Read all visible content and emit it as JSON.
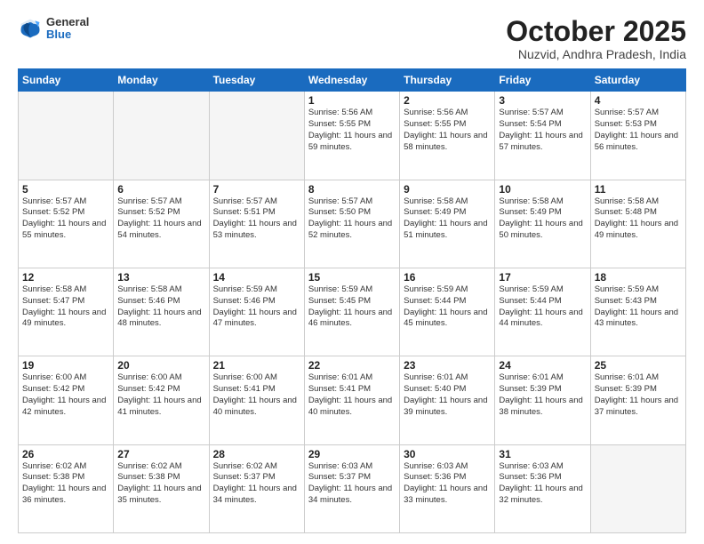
{
  "header": {
    "logo_general": "General",
    "logo_blue": "Blue",
    "month_title": "October 2025",
    "subtitle": "Nuzvid, Andhra Pradesh, India"
  },
  "days_of_week": [
    "Sunday",
    "Monday",
    "Tuesday",
    "Wednesday",
    "Thursday",
    "Friday",
    "Saturday"
  ],
  "weeks": [
    [
      {
        "day": "",
        "text": ""
      },
      {
        "day": "",
        "text": ""
      },
      {
        "day": "",
        "text": ""
      },
      {
        "day": "1",
        "text": "Sunrise: 5:56 AM\nSunset: 5:55 PM\nDaylight: 11 hours\nand 59 minutes."
      },
      {
        "day": "2",
        "text": "Sunrise: 5:56 AM\nSunset: 5:55 PM\nDaylight: 11 hours\nand 58 minutes."
      },
      {
        "day": "3",
        "text": "Sunrise: 5:57 AM\nSunset: 5:54 PM\nDaylight: 11 hours\nand 57 minutes."
      },
      {
        "day": "4",
        "text": "Sunrise: 5:57 AM\nSunset: 5:53 PM\nDaylight: 11 hours\nand 56 minutes."
      }
    ],
    [
      {
        "day": "5",
        "text": "Sunrise: 5:57 AM\nSunset: 5:52 PM\nDaylight: 11 hours\nand 55 minutes."
      },
      {
        "day": "6",
        "text": "Sunrise: 5:57 AM\nSunset: 5:52 PM\nDaylight: 11 hours\nand 54 minutes."
      },
      {
        "day": "7",
        "text": "Sunrise: 5:57 AM\nSunset: 5:51 PM\nDaylight: 11 hours\nand 53 minutes."
      },
      {
        "day": "8",
        "text": "Sunrise: 5:57 AM\nSunset: 5:50 PM\nDaylight: 11 hours\nand 52 minutes."
      },
      {
        "day": "9",
        "text": "Sunrise: 5:58 AM\nSunset: 5:49 PM\nDaylight: 11 hours\nand 51 minutes."
      },
      {
        "day": "10",
        "text": "Sunrise: 5:58 AM\nSunset: 5:49 PM\nDaylight: 11 hours\nand 50 minutes."
      },
      {
        "day": "11",
        "text": "Sunrise: 5:58 AM\nSunset: 5:48 PM\nDaylight: 11 hours\nand 49 minutes."
      }
    ],
    [
      {
        "day": "12",
        "text": "Sunrise: 5:58 AM\nSunset: 5:47 PM\nDaylight: 11 hours\nand 49 minutes."
      },
      {
        "day": "13",
        "text": "Sunrise: 5:58 AM\nSunset: 5:46 PM\nDaylight: 11 hours\nand 48 minutes."
      },
      {
        "day": "14",
        "text": "Sunrise: 5:59 AM\nSunset: 5:46 PM\nDaylight: 11 hours\nand 47 minutes."
      },
      {
        "day": "15",
        "text": "Sunrise: 5:59 AM\nSunset: 5:45 PM\nDaylight: 11 hours\nand 46 minutes."
      },
      {
        "day": "16",
        "text": "Sunrise: 5:59 AM\nSunset: 5:44 PM\nDaylight: 11 hours\nand 45 minutes."
      },
      {
        "day": "17",
        "text": "Sunrise: 5:59 AM\nSunset: 5:44 PM\nDaylight: 11 hours\nand 44 minutes."
      },
      {
        "day": "18",
        "text": "Sunrise: 5:59 AM\nSunset: 5:43 PM\nDaylight: 11 hours\nand 43 minutes."
      }
    ],
    [
      {
        "day": "19",
        "text": "Sunrise: 6:00 AM\nSunset: 5:42 PM\nDaylight: 11 hours\nand 42 minutes."
      },
      {
        "day": "20",
        "text": "Sunrise: 6:00 AM\nSunset: 5:42 PM\nDaylight: 11 hours\nand 41 minutes."
      },
      {
        "day": "21",
        "text": "Sunrise: 6:00 AM\nSunset: 5:41 PM\nDaylight: 11 hours\nand 40 minutes."
      },
      {
        "day": "22",
        "text": "Sunrise: 6:01 AM\nSunset: 5:41 PM\nDaylight: 11 hours\nand 40 minutes."
      },
      {
        "day": "23",
        "text": "Sunrise: 6:01 AM\nSunset: 5:40 PM\nDaylight: 11 hours\nand 39 minutes."
      },
      {
        "day": "24",
        "text": "Sunrise: 6:01 AM\nSunset: 5:39 PM\nDaylight: 11 hours\nand 38 minutes."
      },
      {
        "day": "25",
        "text": "Sunrise: 6:01 AM\nSunset: 5:39 PM\nDaylight: 11 hours\nand 37 minutes."
      }
    ],
    [
      {
        "day": "26",
        "text": "Sunrise: 6:02 AM\nSunset: 5:38 PM\nDaylight: 11 hours\nand 36 minutes."
      },
      {
        "day": "27",
        "text": "Sunrise: 6:02 AM\nSunset: 5:38 PM\nDaylight: 11 hours\nand 35 minutes."
      },
      {
        "day": "28",
        "text": "Sunrise: 6:02 AM\nSunset: 5:37 PM\nDaylight: 11 hours\nand 34 minutes."
      },
      {
        "day": "29",
        "text": "Sunrise: 6:03 AM\nSunset: 5:37 PM\nDaylight: 11 hours\nand 34 minutes."
      },
      {
        "day": "30",
        "text": "Sunrise: 6:03 AM\nSunset: 5:36 PM\nDaylight: 11 hours\nand 33 minutes."
      },
      {
        "day": "31",
        "text": "Sunrise: 6:03 AM\nSunset: 5:36 PM\nDaylight: 11 hours\nand 32 minutes."
      },
      {
        "day": "",
        "text": ""
      }
    ]
  ]
}
